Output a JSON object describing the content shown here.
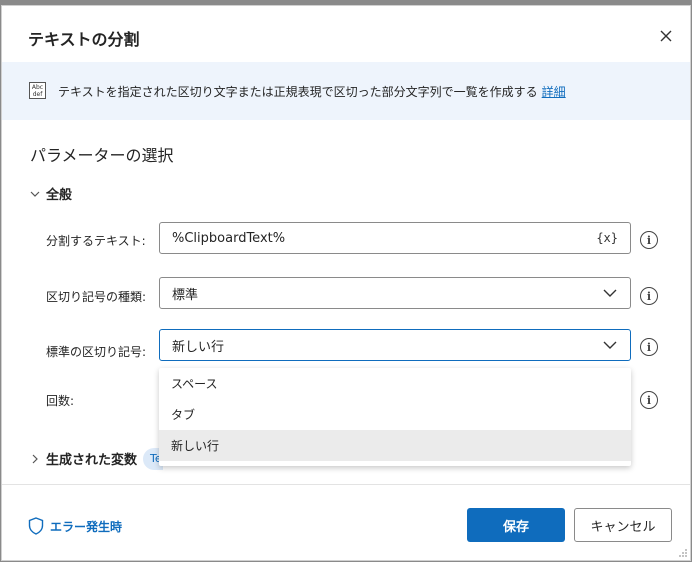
{
  "dialog": {
    "title": "テキストの分割",
    "info": {
      "icon_text_top": "Abc",
      "icon_text_bottom": "def",
      "text": "テキストを指定された区切り文字または正規表現で区切った部分文字列で一覧を作成する",
      "link": "詳細"
    },
    "section_title": "パラメーターの選択",
    "group_general": "全般",
    "fields": {
      "split_text": {
        "label": "分割するテキスト:",
        "value": "%ClipboardText%",
        "var_button": "{x}"
      },
      "delimiter_type": {
        "label": "区切り記号の種類:",
        "value": "標準"
      },
      "standard_delimiter": {
        "label": "標準の区切り記号:",
        "value": "新しい行"
      },
      "count": {
        "label": "回数:"
      }
    },
    "dropdown_options": [
      "スペース",
      "タブ",
      "新しい行"
    ],
    "produced_variables": {
      "label": "生成された変数",
      "chip": "Te"
    },
    "footer": {
      "error_link": "エラー発生時",
      "save": "保存",
      "cancel": "キャンセル"
    },
    "colors": {
      "accent": "#0f6cbd",
      "info_bg": "#eef4fc"
    }
  }
}
